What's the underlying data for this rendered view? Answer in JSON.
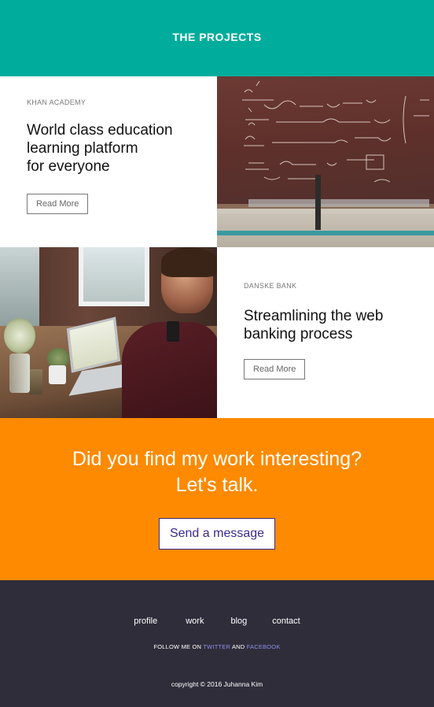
{
  "header": {
    "title": "THE PROJECTS"
  },
  "projects": [
    {
      "client": "KHAN ACADEMY",
      "title": "World class education\nlearning platform\nfor everyone",
      "button": "Read More",
      "image": "chalkboard-photo"
    },
    {
      "client": "DANSKE BANK",
      "title": "Streamlining the web\nbanking process",
      "button": "Read More",
      "image": "workspace-photo"
    }
  ],
  "cta": {
    "line1": "Did you find my work interesting?",
    "line2": "Let's talk.",
    "button": "Send a message"
  },
  "footer": {
    "nav": [
      "profile",
      "work",
      "blog",
      "contact"
    ],
    "follow_prefix": "FOLLOW ME ON",
    "twitter": "TWITTER",
    "and": "AND",
    "facebook": "FACEBOOK",
    "copyright": "copyright © 2016 Juhanna Kim"
  },
  "colors": {
    "header_bg": "#00ad9d",
    "cta_bg": "#fd8a00",
    "footer_bg": "#302d3a",
    "link": "#8a8fe8",
    "button_text": "#3a2a8e"
  }
}
